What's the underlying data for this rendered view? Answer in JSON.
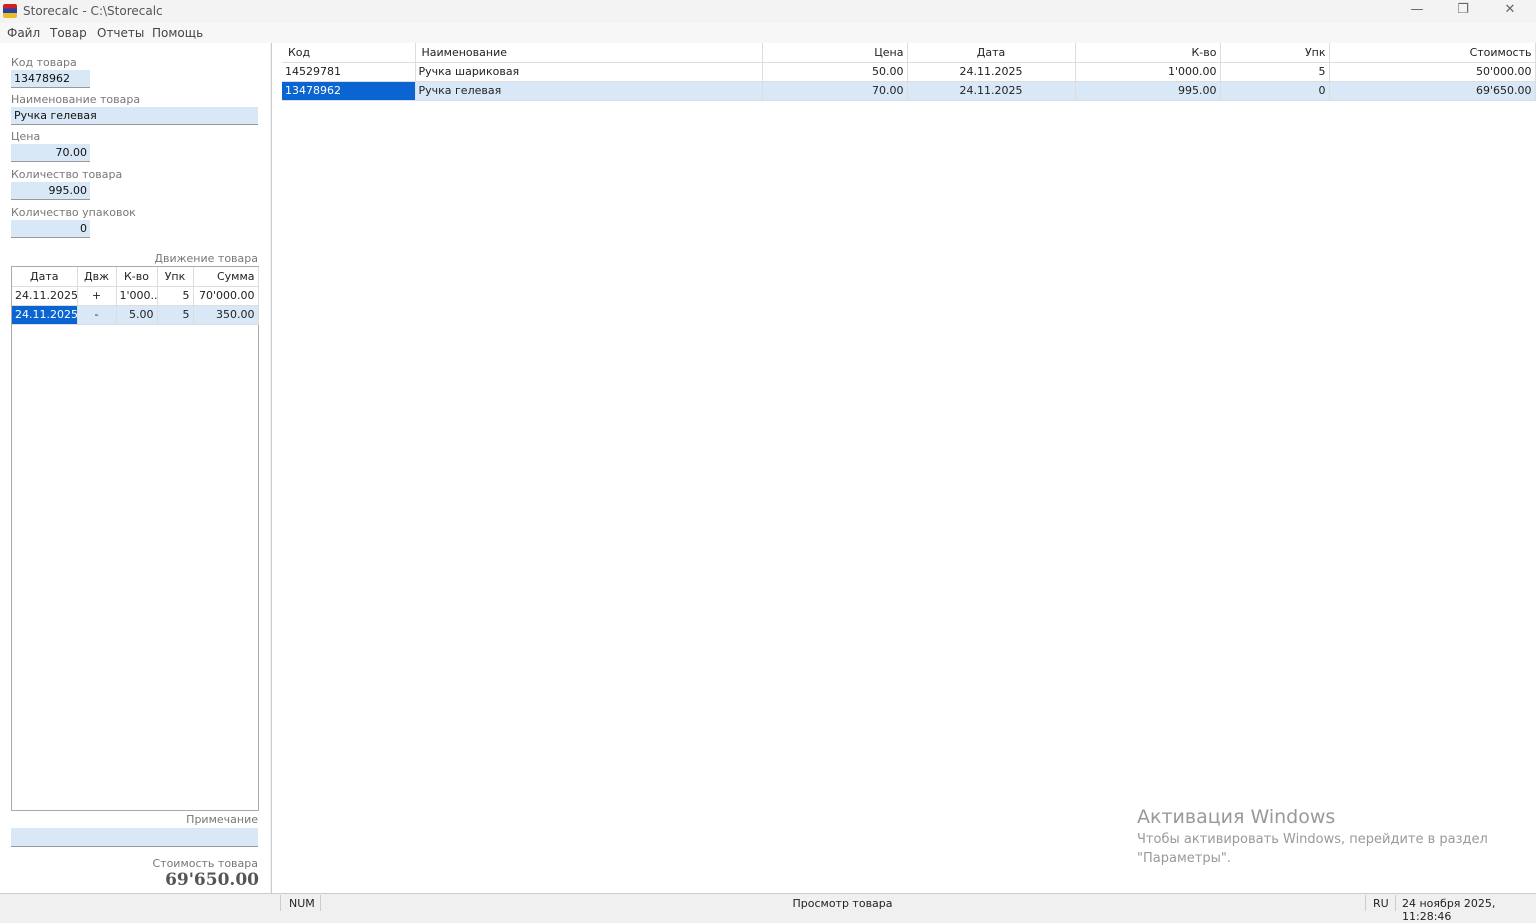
{
  "window": {
    "title": "Storecalc - C:\\Storecalc",
    "minimize": "—",
    "restore": "❐",
    "close": "✕"
  },
  "menu": [
    "Файл",
    "Товар",
    "Отчеты",
    "Помощь"
  ],
  "form": {
    "code_label": "Код товара",
    "code": "13478962",
    "name_label": "Наименование товара",
    "name": "Ручка гелевая",
    "price_label": "Цена",
    "price": "70.00",
    "qty_label": "Количество товара",
    "qty": "995.00",
    "packs_label": "Количество упаковок",
    "packs": "0",
    "movement_label": "Движение товара",
    "note_label": "Примечание",
    "note": "",
    "cost_label": "Стоимость товара",
    "cost": "69'650.00"
  },
  "movements": {
    "headers": [
      "Дата",
      "Двж",
      "К-во",
      "Упк",
      "Сумма"
    ],
    "rows": [
      [
        "24.11.2025",
        "+",
        "1'000...",
        "5",
        "70'000.00"
      ],
      [
        "24.11.2025",
        "-",
        "5.00",
        "5",
        "350.00"
      ]
    ]
  },
  "grid": {
    "headers": [
      "Код",
      "Наименование",
      "Цена",
      "Дата",
      "К-во",
      "Упк",
      "Стоимость"
    ],
    "rows": [
      [
        "14529781",
        "Ручка шариковая",
        "50.00",
        "24.11.2025",
        "1'000.00",
        "5",
        "50'000.00"
      ],
      [
        "13478962",
        "Ручка гелевая",
        "70.00",
        "24.11.2025",
        "995.00",
        "0",
        "69'650.00"
      ]
    ]
  },
  "status": {
    "num": "NUM",
    "mode": "Просмотр товара",
    "lang": "RU",
    "datetime": "24 ноября 2025, 11:28:46"
  },
  "watermark": {
    "title": "Активация Windows",
    "line1": "Чтобы активировать Windows, перейдите в раздел",
    "line2": "\"Параметры\"."
  }
}
